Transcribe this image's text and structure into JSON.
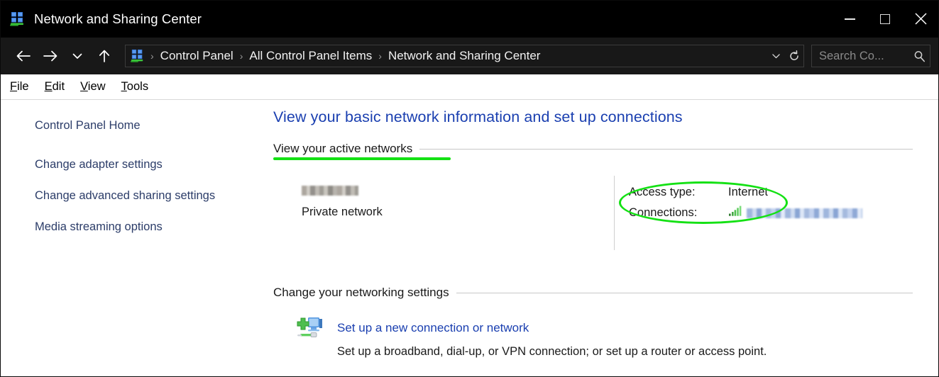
{
  "window": {
    "title": "Network and Sharing Center",
    "title_icon": "network-computers-icon",
    "caption": {
      "minimize": "minimize-icon",
      "maximize": "maximize-icon",
      "close": "close-icon"
    }
  },
  "addressbar": {
    "back_icon": "back-arrow-icon",
    "forward_icon": "forward-arrow-icon",
    "recent_icon": "chevron-down-icon",
    "up_icon": "up-arrow-icon",
    "breadcrumb_icon": "network-computers-icon",
    "separator": "›",
    "crumbs": [
      "Control Panel",
      "All Control Panel Items",
      "Network and Sharing Center"
    ],
    "dropdown_icon": "chevron-down-icon",
    "refresh_icon": "refresh-icon",
    "search": {
      "placeholder": "Search Co...",
      "icon": "search-icon"
    }
  },
  "menubar": {
    "items": [
      {
        "pre": "",
        "accesskey": "F",
        "post": "ile"
      },
      {
        "pre": "",
        "accesskey": "E",
        "post": "dit"
      },
      {
        "pre": "",
        "accesskey": "V",
        "post": "iew"
      },
      {
        "pre": "",
        "accesskey": "T",
        "post": "ools"
      }
    ]
  },
  "sidebar": {
    "items": [
      {
        "label": "Control Panel Home"
      },
      {
        "label": "Change adapter settings"
      },
      {
        "label": "Change advanced sharing settings"
      },
      {
        "label": "Media streaming options"
      }
    ]
  },
  "main": {
    "page_title": "View your basic network information and set up connections",
    "active_networks": {
      "heading": "View your active networks",
      "network_name": "[redacted]",
      "network_type": "Private network",
      "details": [
        {
          "key": "Access type:",
          "value": "Internet"
        },
        {
          "key": "Connections:",
          "value": "[redacted]",
          "icon": "wifi-signal-icon"
        }
      ]
    },
    "networking_settings": {
      "heading": "Change your networking settings",
      "action_icon": "new-connection-icon",
      "action_link": "Set up a new connection or network",
      "action_desc": "Set up a broadband, dial-up, or VPN connection; or set up a router or access point."
    }
  },
  "annotations": {
    "underline_color": "#14e114",
    "ellipse_color": "#14e114"
  }
}
